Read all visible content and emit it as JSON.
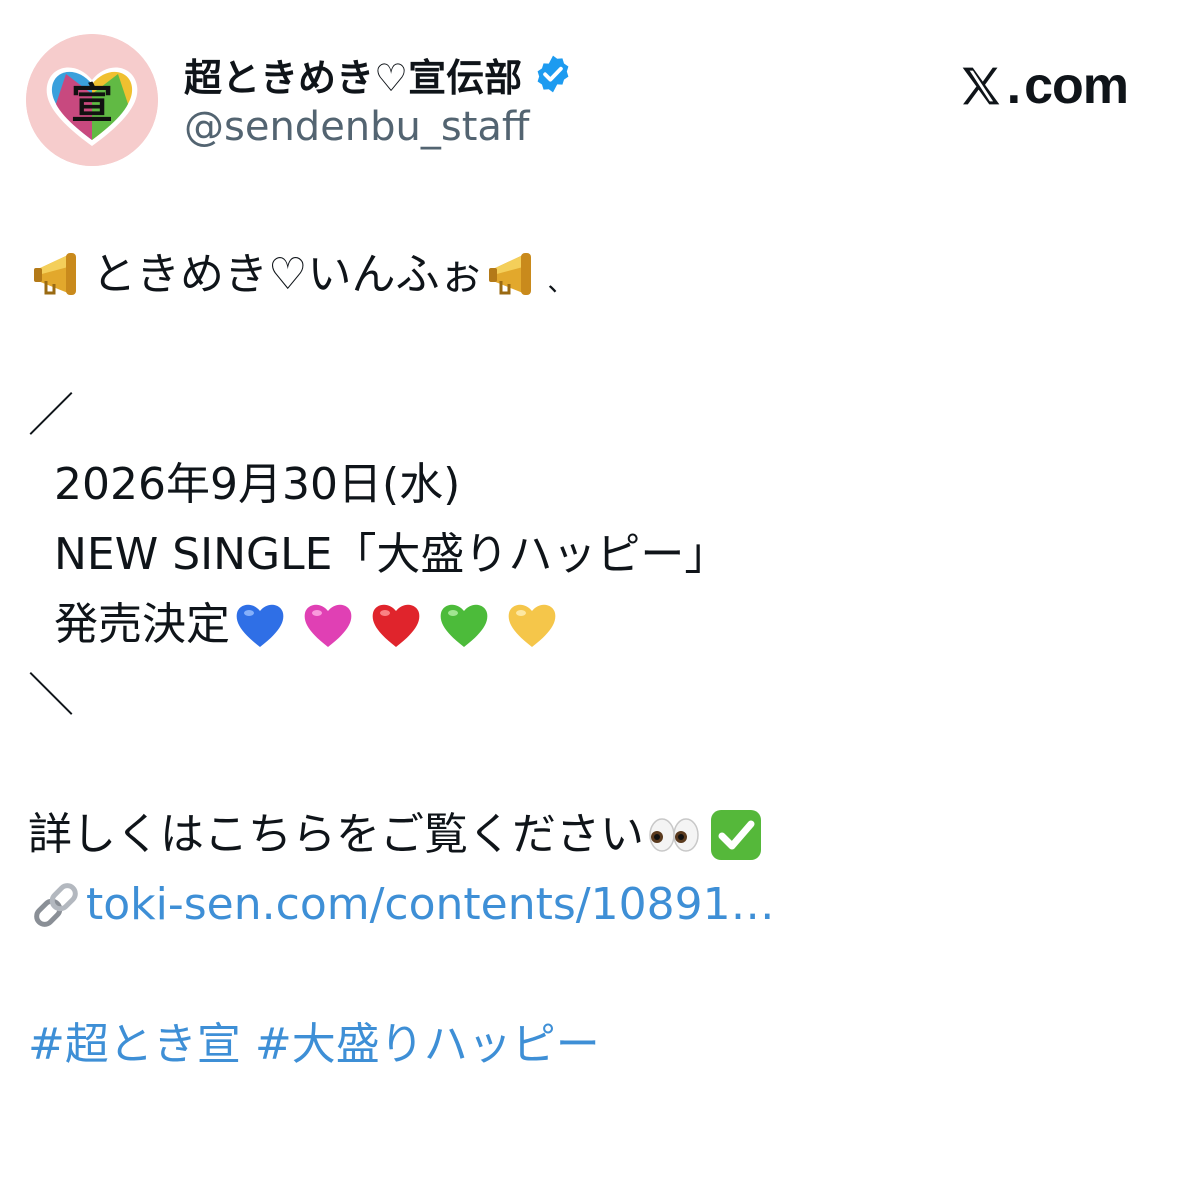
{
  "header": {
    "display_name": "超ときめき♡宣伝部",
    "handle": "@sendenbu_staff",
    "avatar_glyph": "宣",
    "site_label": "com",
    "site_dot": "."
  },
  "tweet": {
    "headline": "ときめき♡いんふぉ",
    "headline_tail": "、",
    "open_bracket": "／",
    "date_line": "2026年9月30日(水)",
    "single_line": "NEW SINGLE「大盛りハッピー」",
    "release_line": "発売決定",
    "close_bracket": "＼",
    "details_line": "詳しくはこちらをご覧ください",
    "link_text": "toki-sen.com/contents/10891…",
    "hashtags": [
      "#超とき宣",
      "#大盛りハッピー"
    ]
  },
  "colors": {
    "link": "#3e8fd6",
    "verified": "#1d9bf0",
    "handle": "#536471",
    "heart_blue": "#2f6fe6",
    "heart_pink": "#e040b4",
    "heart_red": "#e0242c",
    "heart_green": "#4cbb3a",
    "heart_yellow": "#f5c64a"
  },
  "icons": [
    "megaphone-icon",
    "verified-badge-icon",
    "x-logo-icon",
    "eyes-icon",
    "check-mark-icon",
    "link-icon",
    "heart-icon"
  ]
}
